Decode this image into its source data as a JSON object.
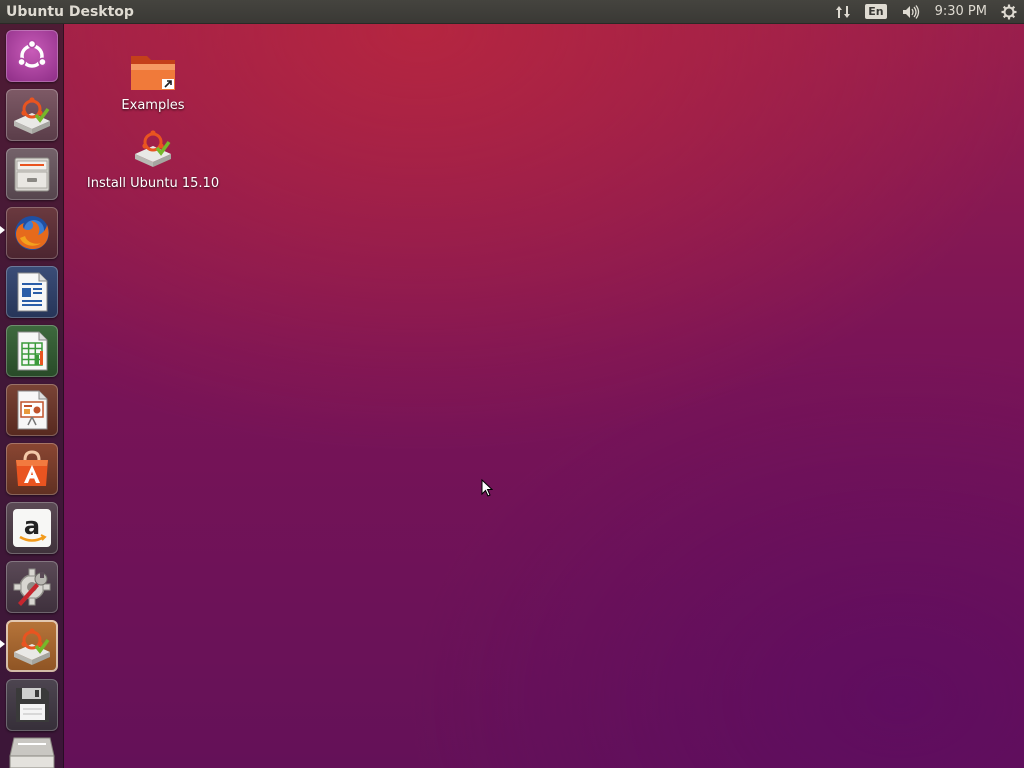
{
  "panel": {
    "title": "Ubuntu Desktop",
    "keyboard_layout": "En",
    "clock": "9:30 PM",
    "indicator_icons": [
      "network-icon",
      "keyboard-layout-icon",
      "volume-icon",
      "session-gear-icon"
    ]
  },
  "launcher": {
    "items": [
      {
        "name": "dash-home",
        "icon": "ubuntu-logo-icon"
      },
      {
        "name": "install-ubuntu",
        "icon": "installer-icon"
      },
      {
        "name": "files",
        "icon": "file-cabinet-icon"
      },
      {
        "name": "firefox",
        "icon": "firefox-icon",
        "running": true
      },
      {
        "name": "libreoffice-writer",
        "icon": "writer-icon"
      },
      {
        "name": "libreoffice-calc",
        "icon": "calc-icon"
      },
      {
        "name": "libreoffice-impress",
        "icon": "impress-icon"
      },
      {
        "name": "ubuntu-software",
        "icon": "software-center-icon"
      },
      {
        "name": "amazon",
        "icon": "amazon-icon"
      },
      {
        "name": "system-settings",
        "icon": "settings-wrench-icon"
      },
      {
        "name": "install-ubuntu-running",
        "icon": "installer-icon",
        "running": true
      },
      {
        "name": "floppy-drive",
        "icon": "floppy-disk-icon"
      },
      {
        "name": "trash",
        "icon": "trash-icon"
      }
    ]
  },
  "desktop": {
    "icons": [
      {
        "label": "Examples",
        "icon": "folder-link-icon"
      },
      {
        "label": "Install Ubuntu 15.10",
        "icon": "installer-icon"
      }
    ]
  },
  "colors": {
    "panel_bg": "#3c3b37",
    "wallpaper_top": "#9b1f4c",
    "wallpaper_bottom": "#641158",
    "ubuntu_orange": "#e95420"
  }
}
